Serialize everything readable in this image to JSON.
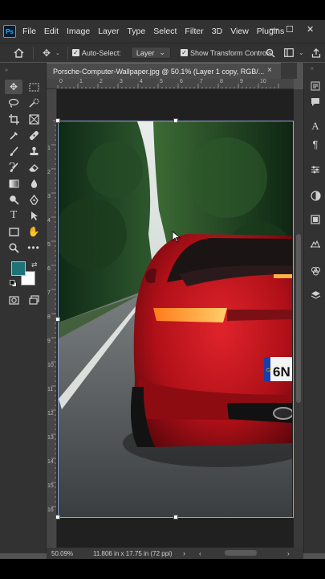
{
  "menu": {
    "app_logo": "Ps",
    "items": [
      "File",
      "Edit",
      "Image",
      "Layer",
      "Type",
      "Select",
      "Filter",
      "3D",
      "View",
      "Plugins"
    ]
  },
  "options": {
    "auto_select_label": "Auto-Select:",
    "auto_select_checked": "✓",
    "target_value": "Layer",
    "show_transform_label": "Show Transform Controls",
    "show_transform_checked": "✓"
  },
  "document": {
    "tab_title": "Porsche-Computer-Wallpaper.jpg @ 50.1% (Layer 1 copy, RGB/...",
    "close_glyph": "×"
  },
  "ruler": {
    "horizontal": [
      "0",
      "1",
      "2",
      "3",
      "4",
      "5",
      "6",
      "7",
      "8",
      "9",
      "10"
    ],
    "vertical": [
      "1",
      "2",
      "3",
      "4",
      "5",
      "6",
      "7",
      "8",
      "9",
      "10",
      "11",
      "12",
      "13",
      "14",
      "15",
      "16"
    ]
  },
  "status": {
    "zoom": "50.09%",
    "doc_size": "11.806 in x 17.75 in (72 ppi)"
  },
  "colors": {
    "foreground": "#1f7378",
    "background": "#ffffff",
    "car_red": "#c8141c"
  },
  "photo": {
    "plate_text": "6N",
    "plate_country": "CZ"
  },
  "tools_left": [
    "move-tool",
    "artboard-tool",
    "lasso-tool",
    "quick-select-tool",
    "crop-tool",
    "frame-tool",
    "eyedropper-tool",
    "spot-healing-tool",
    "brush-tool",
    "clone-stamp-tool",
    "history-brush-tool",
    "eraser-tool",
    "gradient-tool",
    "blur-tool",
    "dodge-tool",
    "pen-tool",
    "type-tool",
    "path-select-tool",
    "rectangle-tool",
    "hand-tool",
    "zoom-tool",
    "more-tools"
  ],
  "panels_right": [
    "history-icon",
    "comments-icon",
    "character-icon",
    "paragraph-icon",
    "adjustments-icon",
    "color-icon",
    "libraries-icon",
    "properties-icon",
    "channels-icon",
    "layers-icon"
  ]
}
